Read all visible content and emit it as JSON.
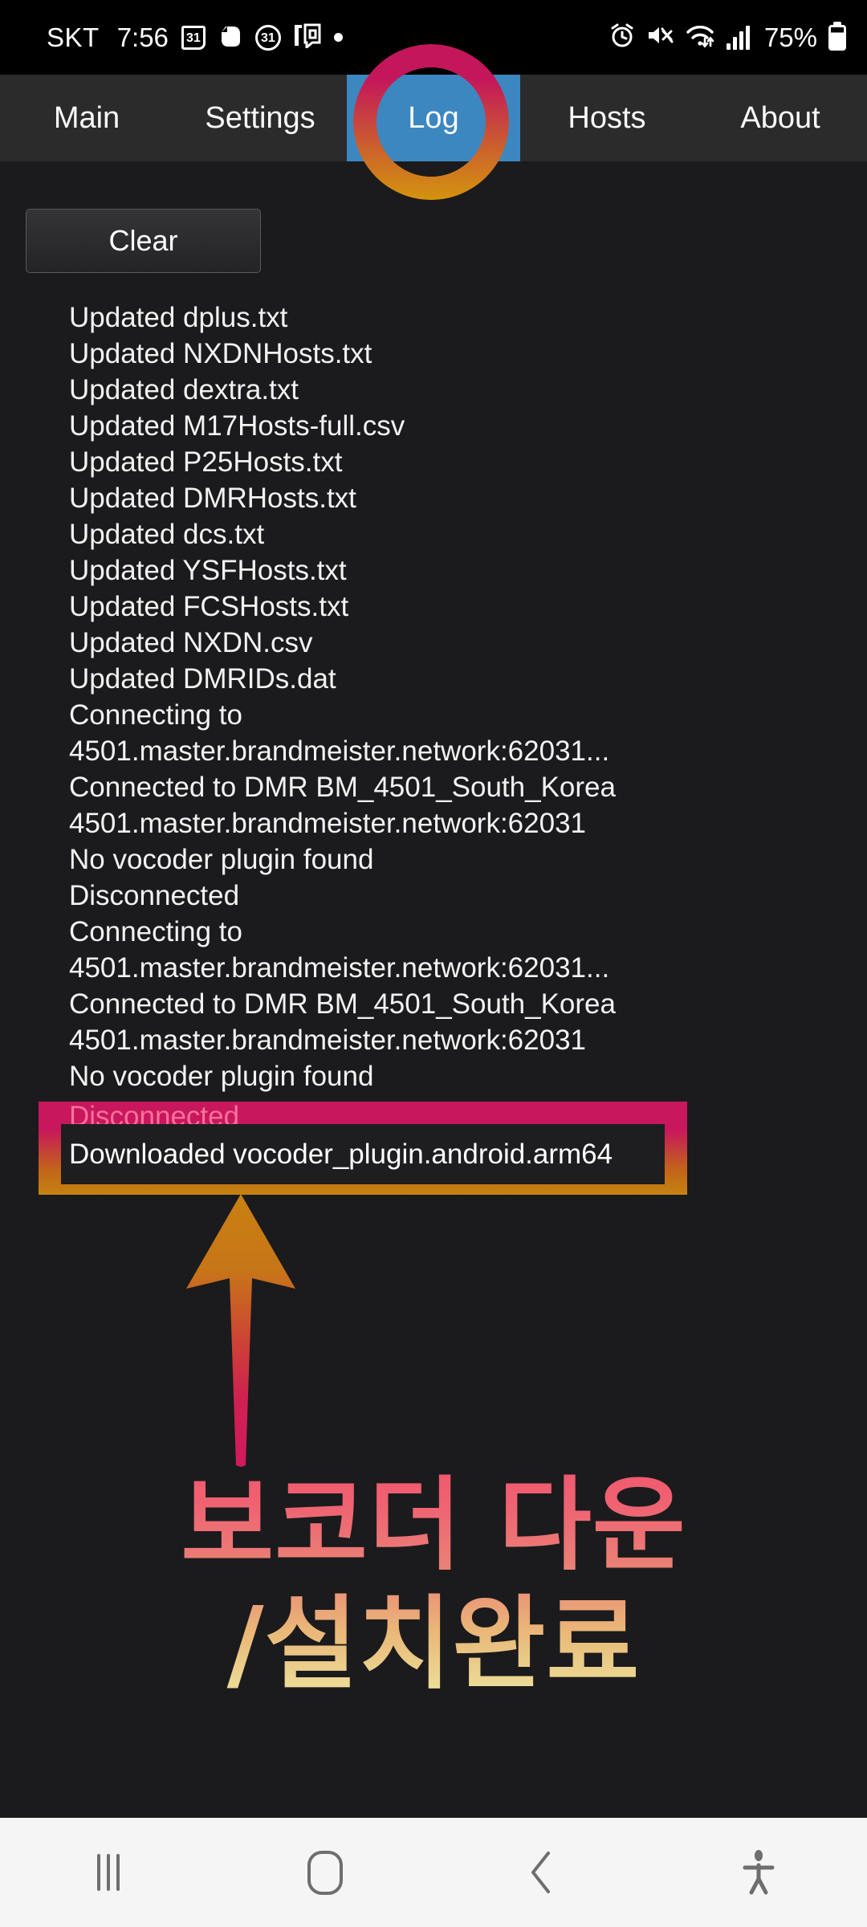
{
  "status_bar": {
    "carrier": "SKT",
    "time": "7:56",
    "icons_left": [
      {
        "name": "calendar-icon",
        "glyph": "31"
      },
      {
        "name": "evernote-icon",
        "glyph": "◗"
      },
      {
        "name": "circled-31-icon",
        "glyph": "31"
      },
      {
        "name": "onem-bank-icon",
        "glyph": "1Q"
      },
      {
        "name": "dot-indicator-icon",
        "glyph": ""
      }
    ],
    "icons_right": [
      {
        "name": "alarm-icon",
        "glyph": "⏰"
      },
      {
        "name": "mute-icon",
        "glyph": "🔇"
      },
      {
        "name": "wifi-icon",
        "glyph": "📶"
      },
      {
        "name": "signal-icon",
        "glyph": ""
      }
    ],
    "battery_percent": "75%"
  },
  "tabs": [
    {
      "label": "Main",
      "selected": false
    },
    {
      "label": "Settings",
      "selected": false
    },
    {
      "label": "Log",
      "selected": true
    },
    {
      "label": "Hosts",
      "selected": false
    },
    {
      "label": "About",
      "selected": false
    }
  ],
  "toolbar": {
    "clear_label": "Clear"
  },
  "log": {
    "lines": [
      "Updated dplus.txt",
      "Updated NXDNHosts.txt",
      "Updated dextra.txt",
      "Updated M17Hosts-full.csv",
      "Updated P25Hosts.txt",
      "Updated DMRHosts.txt",
      "Updated dcs.txt",
      "Updated YSFHosts.txt",
      "Updated FCSHosts.txt",
      "Updated NXDN.csv",
      "Updated DMRIDs.dat",
      "Connecting to 4501.master.brandmeister.network:62031...",
      "Connected to DMR BM_4501_South_Korea",
      "4501.master.brandmeister.network:62031",
      "No vocoder plugin found",
      "Disconnected",
      "Connecting to 4501.master.brandmeister.network:62031...",
      "Connected to DMR BM_4501_South_Korea",
      "4501.master.brandmeister.network:62031",
      "No vocoder plugin found"
    ]
  },
  "annotation": {
    "highlighted_status_line": "Disconnected",
    "highlighted_line": "Downloaded vocoder_plugin.android.arm64",
    "callout_line1": "보코더 다운",
    "callout_line2": "/설치완료",
    "colors": {
      "circle_top": "#c4165b",
      "circle_bottom": "#d4930e",
      "box_top": "#c8175c",
      "box_bottom": "#c5840f",
      "arrow_top": "#c97d12",
      "arrow_bottom": "#d11a5e",
      "text_top": "#f0576e",
      "text_bottom": "#ece6a0",
      "tab_selected": "#3d87c0",
      "disconnected_text": "#f9709c"
    }
  },
  "nav_bar": {
    "items": [
      {
        "name": "recents-button",
        "label": "|||"
      },
      {
        "name": "home-button",
        "label": "◯"
      },
      {
        "name": "back-button",
        "label": "‹"
      },
      {
        "name": "accessibility-button",
        "label": "෴"
      }
    ]
  }
}
